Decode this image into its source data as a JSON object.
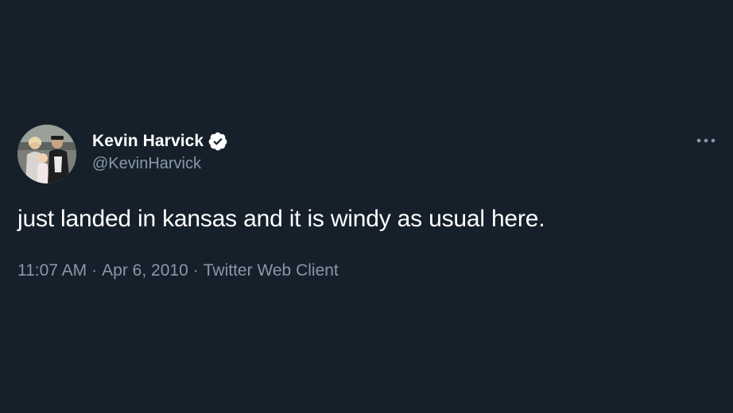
{
  "tweet": {
    "display_name": "Kevin Harvick",
    "handle": "@KevinHarvick",
    "verified_icon": "verified-badge-icon",
    "text": "just landed in kansas and it is windy as usual here.",
    "time": "11:07 AM",
    "separator": "·",
    "date": "Apr 6, 2010",
    "client": "Twitter Web Client",
    "more_icon": "more-options-icon"
  },
  "colors": {
    "background": "#15202b",
    "text_primary": "#ffffff",
    "text_secondary": "#8899a6"
  }
}
